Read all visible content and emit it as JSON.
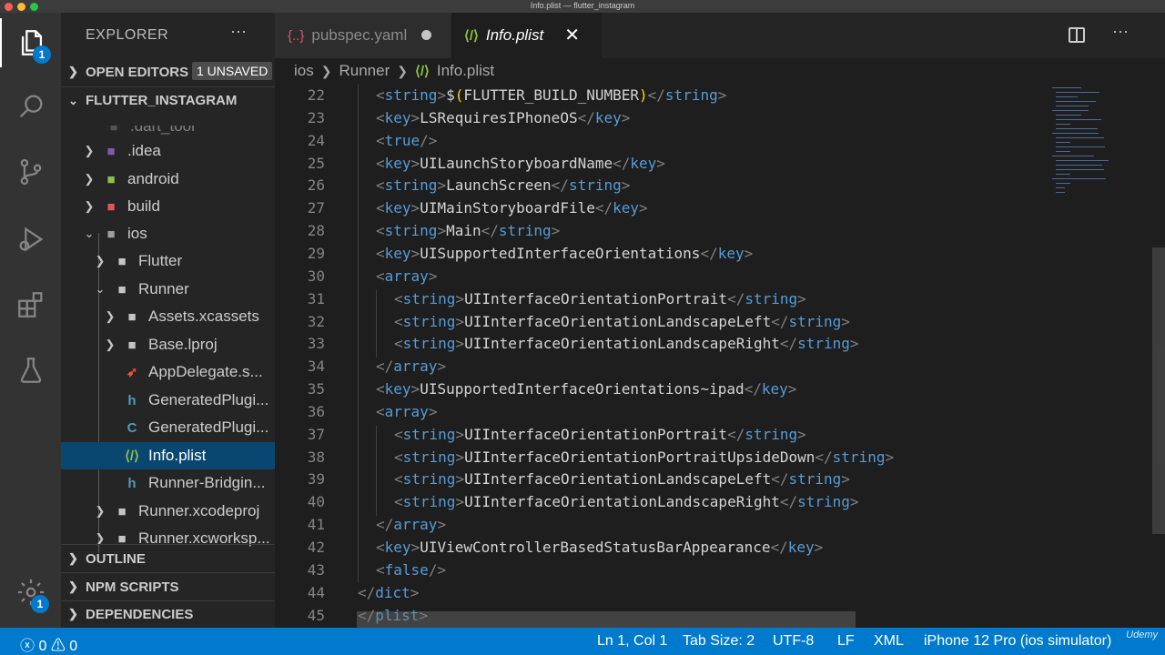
{
  "window": {
    "title": "Info.plist — flutter_instagram"
  },
  "activity_bar": {
    "explorer_badge": "1",
    "settings_badge": "1"
  },
  "sidebar": {
    "title": "EXPLORER",
    "more": "···",
    "open_editors": {
      "label": "OPEN EDITORS",
      "badge": "1 UNSAVED"
    },
    "project": {
      "label": "FLUTTER_INSTAGRAM"
    },
    "tree": [
      {
        "name": ".dart_tool",
        "type": "folder"
      },
      {
        "name": ".idea",
        "type": "folder"
      },
      {
        "name": "android",
        "type": "folder"
      },
      {
        "name": "build",
        "type": "folder"
      },
      {
        "name": "ios",
        "type": "folder"
      },
      {
        "name": "Flutter",
        "type": "folder"
      },
      {
        "name": "Runner",
        "type": "folder"
      },
      {
        "name": "Assets.xcassets",
        "type": "folder"
      },
      {
        "name": "Base.lproj",
        "type": "folder"
      },
      {
        "name": "AppDelegate.swift",
        "display": "AppDelegate.s...",
        "type": "swift"
      },
      {
        "name": "GeneratedPluginRegistrant.h",
        "display": "GeneratedPlugi...",
        "type": "h",
        "icon": "h"
      },
      {
        "name": "GeneratedPluginRegistrant.m",
        "display": "GeneratedPlugi...",
        "type": "c",
        "icon": "C"
      },
      {
        "name": "Info.plist",
        "type": "plist"
      },
      {
        "name": "Runner-Bridging-Header.h",
        "display": "Runner-Bridgin...",
        "type": "h",
        "icon": "h"
      },
      {
        "name": "Runner.xcodeproj",
        "type": "folder"
      },
      {
        "name": "Runner.xcworkspace",
        "display": "Runner.xcworksp...",
        "type": "folder"
      }
    ],
    "outline": "OUTLINE",
    "npm_scripts": "NPM SCRIPTS",
    "dependencies": "DEPENDENCIES"
  },
  "tabs": [
    {
      "label": "pubspec.yaml",
      "icon": "{..}",
      "unsaved": true
    },
    {
      "label": "Info.plist",
      "icon": "plist-icon",
      "active": true,
      "close": "✕"
    }
  ],
  "breadcrumb": [
    "ios",
    "Runner",
    "Info.plist"
  ],
  "editor": {
    "lines": [
      {
        "n": "22",
        "indent": 1,
        "parts": [
          [
            "br",
            "<"
          ],
          [
            "tag",
            "string"
          ],
          [
            "br",
            ">"
          ],
          [
            "txt",
            "$"
          ],
          [
            "sym",
            "("
          ],
          [
            "txt",
            "FLUTTER_BUILD_NUMBER"
          ],
          [
            "sym",
            ")"
          ],
          [
            "br",
            "</"
          ],
          [
            "tag",
            "string"
          ],
          [
            "br",
            ">"
          ]
        ]
      },
      {
        "n": "23",
        "indent": 1,
        "parts": [
          [
            "br",
            "<"
          ],
          [
            "tag",
            "key"
          ],
          [
            "br",
            ">"
          ],
          [
            "txt",
            "LSRequiresIPhoneOS"
          ],
          [
            "br",
            "</"
          ],
          [
            "tag",
            "key"
          ],
          [
            "br",
            ">"
          ]
        ]
      },
      {
        "n": "24",
        "indent": 1,
        "parts": [
          [
            "br",
            "<"
          ],
          [
            "tag",
            "true"
          ],
          [
            "br",
            "/>"
          ]
        ]
      },
      {
        "n": "25",
        "indent": 1,
        "parts": [
          [
            "br",
            "<"
          ],
          [
            "tag",
            "key"
          ],
          [
            "br",
            ">"
          ],
          [
            "txt",
            "UILaunchStoryboardName"
          ],
          [
            "br",
            "</"
          ],
          [
            "tag",
            "key"
          ],
          [
            "br",
            ">"
          ]
        ]
      },
      {
        "n": "26",
        "indent": 1,
        "parts": [
          [
            "br",
            "<"
          ],
          [
            "tag",
            "string"
          ],
          [
            "br",
            ">"
          ],
          [
            "txt",
            "LaunchScreen"
          ],
          [
            "br",
            "</"
          ],
          [
            "tag",
            "string"
          ],
          [
            "br",
            ">"
          ]
        ]
      },
      {
        "n": "27",
        "indent": 1,
        "parts": [
          [
            "br",
            "<"
          ],
          [
            "tag",
            "key"
          ],
          [
            "br",
            ">"
          ],
          [
            "txt",
            "UIMainStoryboardFile"
          ],
          [
            "br",
            "</"
          ],
          [
            "tag",
            "key"
          ],
          [
            "br",
            ">"
          ]
        ]
      },
      {
        "n": "28",
        "indent": 1,
        "parts": [
          [
            "br",
            "<"
          ],
          [
            "tag",
            "string"
          ],
          [
            "br",
            ">"
          ],
          [
            "txt",
            "Main"
          ],
          [
            "br",
            "</"
          ],
          [
            "tag",
            "string"
          ],
          [
            "br",
            ">"
          ]
        ]
      },
      {
        "n": "29",
        "indent": 1,
        "parts": [
          [
            "br",
            "<"
          ],
          [
            "tag",
            "key"
          ],
          [
            "br",
            ">"
          ],
          [
            "txt",
            "UISupportedInterfaceOrientations"
          ],
          [
            "br",
            "</"
          ],
          [
            "tag",
            "key"
          ],
          [
            "br",
            ">"
          ]
        ]
      },
      {
        "n": "30",
        "indent": 1,
        "parts": [
          [
            "br",
            "<"
          ],
          [
            "tag",
            "array"
          ],
          [
            "br",
            ">"
          ]
        ]
      },
      {
        "n": "31",
        "indent": 2,
        "parts": [
          [
            "br",
            "<"
          ],
          [
            "tag",
            "string"
          ],
          [
            "br",
            ">"
          ],
          [
            "txt",
            "UIInterfaceOrientationPortrait"
          ],
          [
            "br",
            "</"
          ],
          [
            "tag",
            "string"
          ],
          [
            "br",
            ">"
          ]
        ]
      },
      {
        "n": "32",
        "indent": 2,
        "parts": [
          [
            "br",
            "<"
          ],
          [
            "tag",
            "string"
          ],
          [
            "br",
            ">"
          ],
          [
            "txt",
            "UIInterfaceOrientationLandscapeLeft"
          ],
          [
            "br",
            "</"
          ],
          [
            "tag",
            "string"
          ],
          [
            "br",
            ">"
          ]
        ]
      },
      {
        "n": "33",
        "indent": 2,
        "parts": [
          [
            "br",
            "<"
          ],
          [
            "tag",
            "string"
          ],
          [
            "br",
            ">"
          ],
          [
            "txt",
            "UIInterfaceOrientationLandscapeRight"
          ],
          [
            "br",
            "</"
          ],
          [
            "tag",
            "string"
          ],
          [
            "br",
            ">"
          ]
        ]
      },
      {
        "n": "34",
        "indent": 1,
        "parts": [
          [
            "br",
            "</"
          ],
          [
            "tag",
            "array"
          ],
          [
            "br",
            ">"
          ]
        ]
      },
      {
        "n": "35",
        "indent": 1,
        "parts": [
          [
            "br",
            "<"
          ],
          [
            "tag",
            "key"
          ],
          [
            "br",
            ">"
          ],
          [
            "txt",
            "UISupportedInterfaceOrientations~ipad"
          ],
          [
            "br",
            "</"
          ],
          [
            "tag",
            "key"
          ],
          [
            "br",
            ">"
          ]
        ]
      },
      {
        "n": "36",
        "indent": 1,
        "parts": [
          [
            "br",
            "<"
          ],
          [
            "tag",
            "array"
          ],
          [
            "br",
            ">"
          ]
        ]
      },
      {
        "n": "37",
        "indent": 2,
        "parts": [
          [
            "br",
            "<"
          ],
          [
            "tag",
            "string"
          ],
          [
            "br",
            ">"
          ],
          [
            "txt",
            "UIInterfaceOrientationPortrait"
          ],
          [
            "br",
            "</"
          ],
          [
            "tag",
            "string"
          ],
          [
            "br",
            ">"
          ]
        ]
      },
      {
        "n": "38",
        "indent": 2,
        "parts": [
          [
            "br",
            "<"
          ],
          [
            "tag",
            "string"
          ],
          [
            "br",
            ">"
          ],
          [
            "txt",
            "UIInterfaceOrientationPortraitUpsideDown"
          ],
          [
            "br",
            "</"
          ],
          [
            "tag",
            "string"
          ],
          [
            "br",
            ">"
          ]
        ]
      },
      {
        "n": "39",
        "indent": 2,
        "parts": [
          [
            "br",
            "<"
          ],
          [
            "tag",
            "string"
          ],
          [
            "br",
            ">"
          ],
          [
            "txt",
            "UIInterfaceOrientationLandscapeLeft"
          ],
          [
            "br",
            "</"
          ],
          [
            "tag",
            "string"
          ],
          [
            "br",
            ">"
          ]
        ]
      },
      {
        "n": "40",
        "indent": 2,
        "parts": [
          [
            "br",
            "<"
          ],
          [
            "tag",
            "string"
          ],
          [
            "br",
            ">"
          ],
          [
            "txt",
            "UIInterfaceOrientationLandscapeRight"
          ],
          [
            "br",
            "</"
          ],
          [
            "tag",
            "string"
          ],
          [
            "br",
            ">"
          ]
        ]
      },
      {
        "n": "41",
        "indent": 1,
        "parts": [
          [
            "br",
            "</"
          ],
          [
            "tag",
            "array"
          ],
          [
            "br",
            ">"
          ]
        ]
      },
      {
        "n": "42",
        "indent": 1,
        "parts": [
          [
            "br",
            "<"
          ],
          [
            "tag",
            "key"
          ],
          [
            "br",
            ">"
          ],
          [
            "txt",
            "UIViewControllerBasedStatusBarAppearance"
          ],
          [
            "br",
            "</"
          ],
          [
            "tag",
            "key"
          ],
          [
            "br",
            ">"
          ]
        ]
      },
      {
        "n": "43",
        "indent": 1,
        "parts": [
          [
            "br",
            "<"
          ],
          [
            "tag",
            "false"
          ],
          [
            "br",
            "/>"
          ]
        ]
      },
      {
        "n": "44",
        "indent": 0,
        "parts": [
          [
            "br",
            "</"
          ],
          [
            "tag",
            "dict"
          ],
          [
            "br",
            ">"
          ]
        ]
      },
      {
        "n": "45",
        "indent": 0,
        "parts": [
          [
            "br",
            "</"
          ],
          [
            "tag",
            "plist"
          ],
          [
            "br",
            ">"
          ]
        ]
      }
    ]
  },
  "statusbar": {
    "errors": "0",
    "warnings": "0",
    "position": "Ln 1, Col 1",
    "tab_size": "Tab Size: 2",
    "encoding": "UTF-8",
    "eol": "LF",
    "language": "XML",
    "device": "iPhone 12 Pro (ios simulator)",
    "watermark": "Udemy"
  },
  "colors": {
    "accent": "#007acc",
    "tag": "#569cd6",
    "bracket": "#808080",
    "text": "#d4d4d4",
    "symbol": "#ffd700",
    "selection": "#094771"
  }
}
